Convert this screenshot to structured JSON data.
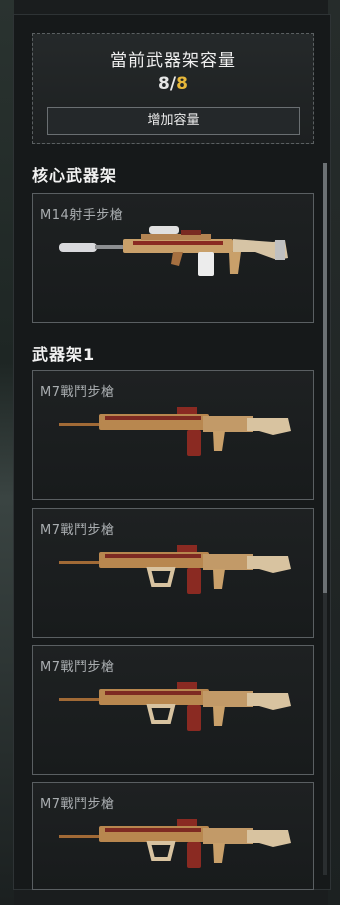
{
  "capacity": {
    "title": "當前武器架容量",
    "current": "8",
    "separator": "/",
    "max": "8",
    "add_button_label": "增加容量"
  },
  "sections": [
    {
      "title": "核心武器架"
    },
    {
      "title": "武器架1"
    }
  ],
  "slots": [
    {
      "name": "M14射手步槍",
      "icon": "marksman-rifle-icon"
    },
    {
      "name": "M7戰鬥步槍",
      "icon": "assault-rifle-icon"
    },
    {
      "name": "M7戰鬥步槍",
      "icon": "assault-rifle-icon"
    },
    {
      "name": "M7戰鬥步槍",
      "icon": "assault-rifle-icon"
    },
    {
      "name": "M7戰鬥步槍",
      "icon": "assault-rifle-icon"
    }
  ],
  "colors": {
    "accent_gold": "#e8b83a",
    "weapon_skin_gold": "#c9a06a",
    "weapon_skin_red": "#8a2a22"
  }
}
